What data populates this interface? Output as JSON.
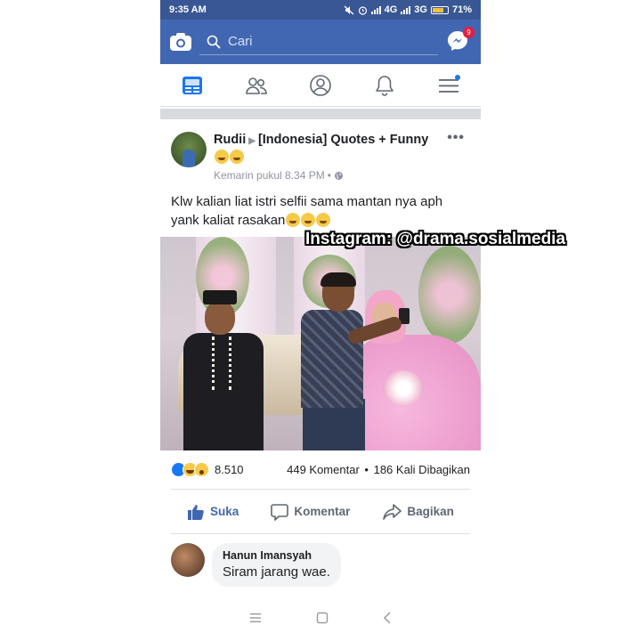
{
  "status_bar": {
    "time": "9:35 AM",
    "network1": "4G",
    "network2": "3G",
    "battery": "71%"
  },
  "header": {
    "search_placeholder": "Cari",
    "messenger_badge": "9"
  },
  "nav": {
    "tabs": [
      "news-feed",
      "friends",
      "profile",
      "notifications",
      "menu"
    ]
  },
  "post": {
    "author": "Rudii",
    "group": "[Indonesia] Quotes + Funny",
    "timestamp": "Kemarin pukul 8.34 PM",
    "text": "Klw kalian liat istri selfii sama mantan nya aph yank kaliat rasakan",
    "watermark": "Instagram: @drama.sosialmedia",
    "reaction_count": "8.510",
    "comments_count": "449 Komentar",
    "shares_count": "186 Kali Dibagikan",
    "separator": "•"
  },
  "actions": {
    "like": "Suka",
    "comment": "Komentar",
    "share": "Bagikan"
  },
  "comment": {
    "name": "Hanun Imansyah",
    "text": "Siram jarang wae."
  },
  "colors": {
    "brand": "#4267b2",
    "status_bar": "#3a5795",
    "badge": "#e41e3f"
  }
}
